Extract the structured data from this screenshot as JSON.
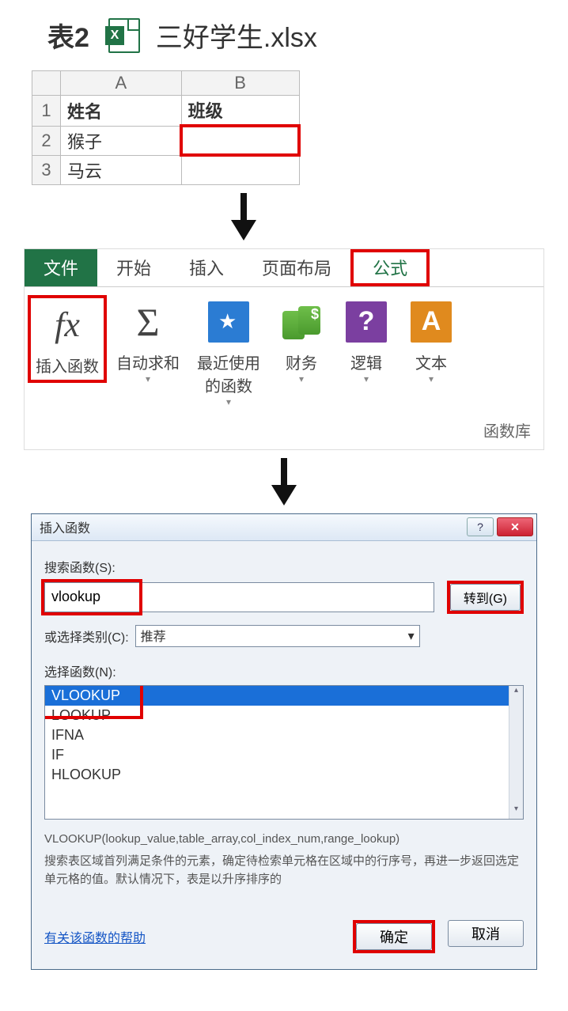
{
  "header": {
    "table_label": "表2",
    "file_name": "三好学生.xlsx",
    "file_icon_letter": "X"
  },
  "sheet": {
    "columns": [
      "A",
      "B"
    ],
    "rows": [
      {
        "num": "1",
        "a": "姓名",
        "b": "班级",
        "bold": true
      },
      {
        "num": "2",
        "a": "猴子",
        "b": "",
        "b_red": true
      },
      {
        "num": "3",
        "a": "马云",
        "b": ""
      }
    ]
  },
  "ribbon": {
    "tabs": {
      "file": "文件",
      "home": "开始",
      "insert": "插入",
      "layout": "页面布局",
      "formula": "公式"
    },
    "buttons": {
      "insert_fn": "插入函数",
      "autosum": "自动求和",
      "recent": "最近使用的函数",
      "finance": "财务",
      "logic": "逻辑",
      "text": "文本"
    },
    "group_label": "函数库",
    "fx_glyph": "fx",
    "sum_glyph": "Σ",
    "question_glyph": "?",
    "a_glyph": "A",
    "dd_glyph": "▾"
  },
  "dialog": {
    "title": "插入函数",
    "help_glyph": "?",
    "close_glyph": "✕",
    "search_label": "搜索函数(S):",
    "search_value": "vlookup",
    "go_btn": "转到(G)",
    "category_label": "或选择类别(C):",
    "category_value": "推荐",
    "select_label": "选择函数(N):",
    "list": [
      "VLOOKUP",
      "LOOKUP",
      "IFNA",
      "IF",
      "HLOOKUP"
    ],
    "syntax": "VLOOKUP(lookup_value,table_array,col_index_num,range_lookup)",
    "desc": "搜索表区域首列满足条件的元素，确定待检索单元格在区域中的行序号，再进一步返回选定单元格的值。默认情况下，表是以升序排序的",
    "help_link": "有关该函数的帮助",
    "ok": "确定",
    "cancel": "取消",
    "scroll_up": "▴",
    "scroll_dn": "▾"
  }
}
